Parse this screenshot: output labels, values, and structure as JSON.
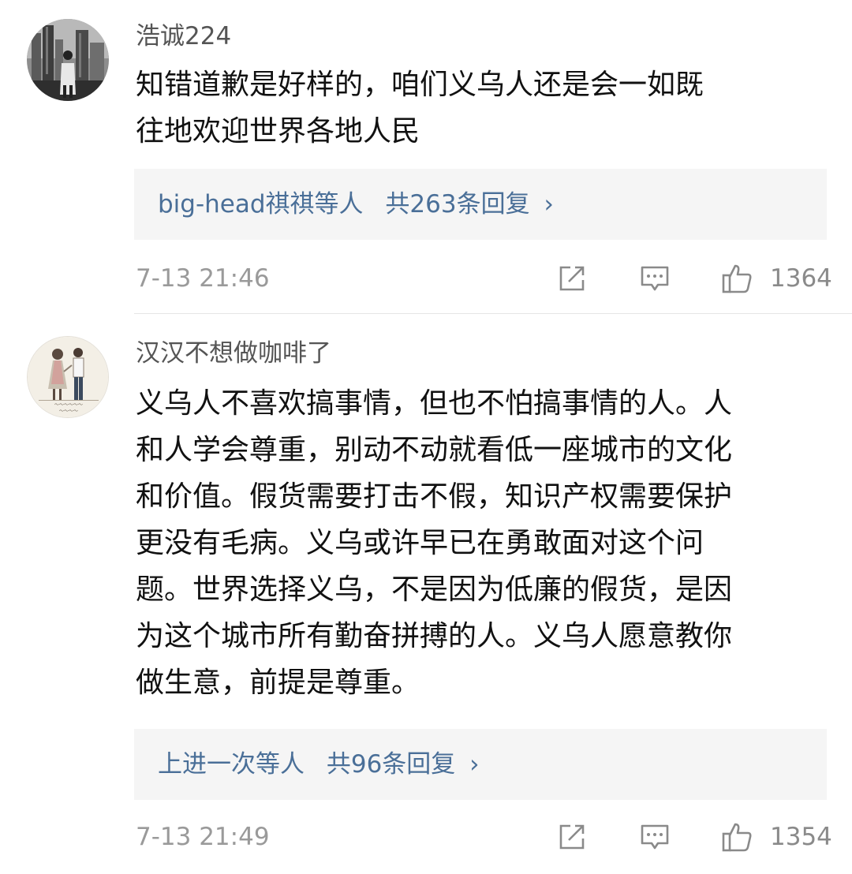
{
  "comments": [
    {
      "avatar_icon": "city-photo-avatar",
      "username": "浩诚224",
      "content": "知错道歉是好样的，咱们义乌人还是会一如既\n往地欢迎世界各地人民",
      "reply_users": "big-head祺祺等人",
      "reply_count": "共263条回复",
      "reply_chevron": "›",
      "timestamp": "7-13 21:46",
      "like_count": "1364"
    },
    {
      "avatar_icon": "illustrated-couple-avatar",
      "username": "汉汉不想做咖啡了",
      "content": "义乌人不喜欢搞事情，但也不怕搞事情的人。人\n和人学会尊重，别动不动就看低一座城市的文化\n和价值。假货需要打击不假，知识产权需要保护\n更没有毛病。义乌或许早已在勇敢面对这个问\n题。世界选择义乌，不是因为低廉的假货，是因\n为这个城市所有勤奋拼搏的人。义乌人愿意教你\n做生意，前提是尊重。",
      "reply_users": "上进一次等人",
      "reply_count": "共96条回复",
      "reply_chevron": "›",
      "timestamp": "7-13 21:49",
      "like_count": "1354"
    }
  ],
  "icons": {
    "share": "share-icon",
    "comment": "comment-icon",
    "like": "thumbs-up-icon"
  },
  "colors": {
    "reply_link": "#4a6f98",
    "meta_gray": "#9a9a9a",
    "reply_bg": "#f5f5f5"
  }
}
